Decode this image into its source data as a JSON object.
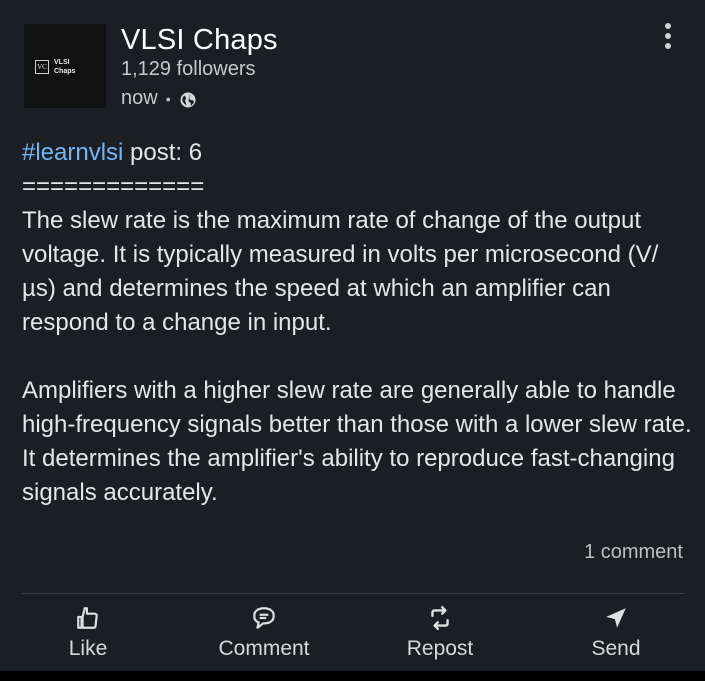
{
  "post": {
    "author": {
      "name": "VLSI Chaps",
      "followers": "1,129 followers",
      "time": "now",
      "visibility_icon": "globe-icon",
      "logo_mark": "VC",
      "logo_line1": "VLSI",
      "logo_line2": "Chaps"
    },
    "hashtag": "#learnvlsi",
    "title_rest": " post: 6",
    "separator": "=============",
    "paragraph1": "The slew rate is the maximum rate of change of the output voltage. It is typically measured in volts per microsecond (V/µs) and determines the speed at which an amplifier can respond to a change in input.",
    "paragraph2": "Amplifiers with a higher slew rate are generally able to handle high-frequency signals better than those with a lower slew rate. It determines the amplifier's ability to reproduce fast-changing signals accurately.",
    "comments": "1 comment"
  },
  "actions": {
    "like": "Like",
    "comment": "Comment",
    "repost": "Repost",
    "send": "Send"
  },
  "colors": {
    "background": "#1b1f23",
    "hashtag": "#71b7fb",
    "text": "#e6e6e6"
  }
}
